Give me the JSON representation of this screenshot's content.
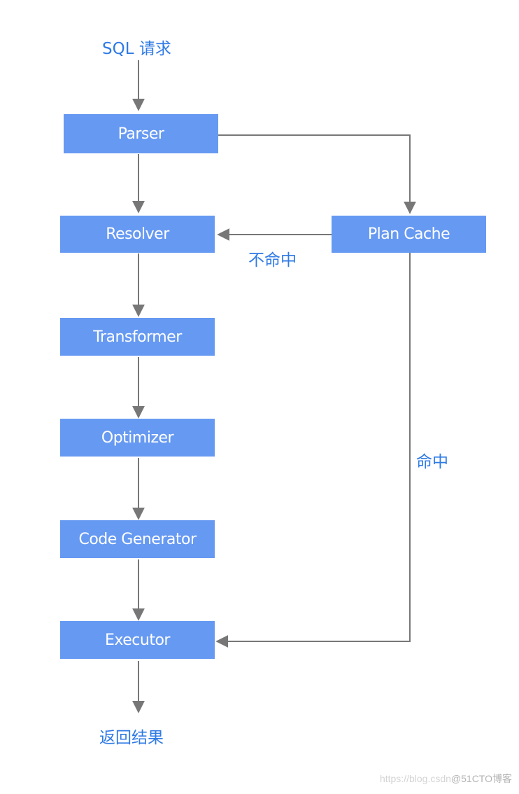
{
  "diagram": {
    "start_label": "SQL 请求",
    "end_label": "返回结果",
    "nodes": {
      "parser": "Parser",
      "resolver": "Resolver",
      "transformer": "Transformer",
      "optimizer": "Optimizer",
      "code_generator": "Code Generator",
      "executor": "Executor",
      "plan_cache": "Plan Cache"
    },
    "edge_labels": {
      "miss": "不命中",
      "hit": "命中"
    },
    "edges": [
      {
        "from": "start",
        "to": "parser"
      },
      {
        "from": "parser",
        "to": "resolver"
      },
      {
        "from": "parser",
        "to": "plan_cache"
      },
      {
        "from": "plan_cache",
        "to": "resolver",
        "label": "不命中"
      },
      {
        "from": "plan_cache",
        "to": "executor",
        "label": "命中"
      },
      {
        "from": "resolver",
        "to": "transformer"
      },
      {
        "from": "transformer",
        "to": "optimizer"
      },
      {
        "from": "optimizer",
        "to": "code_generator"
      },
      {
        "from": "code_generator",
        "to": "executor"
      },
      {
        "from": "executor",
        "to": "end"
      }
    ],
    "colors": {
      "node_fill": "#6699f2",
      "node_text": "#ffffff",
      "label_text": "#2f7ae5",
      "edge": "#777777"
    }
  },
  "watermark": {
    "url": "https://blog.csdn",
    "brand": "@51CTO博客"
  }
}
